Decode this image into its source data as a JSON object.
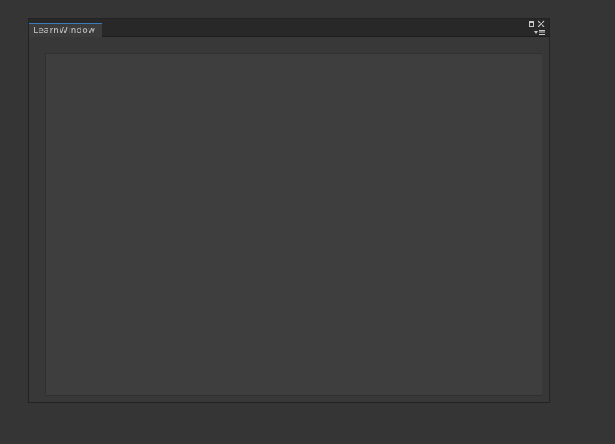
{
  "window": {
    "tab_title": "LearnWindow"
  },
  "icons": {
    "maximize": "maximize-icon",
    "close": "close-icon",
    "menu": "dropdown-menu-icon"
  }
}
